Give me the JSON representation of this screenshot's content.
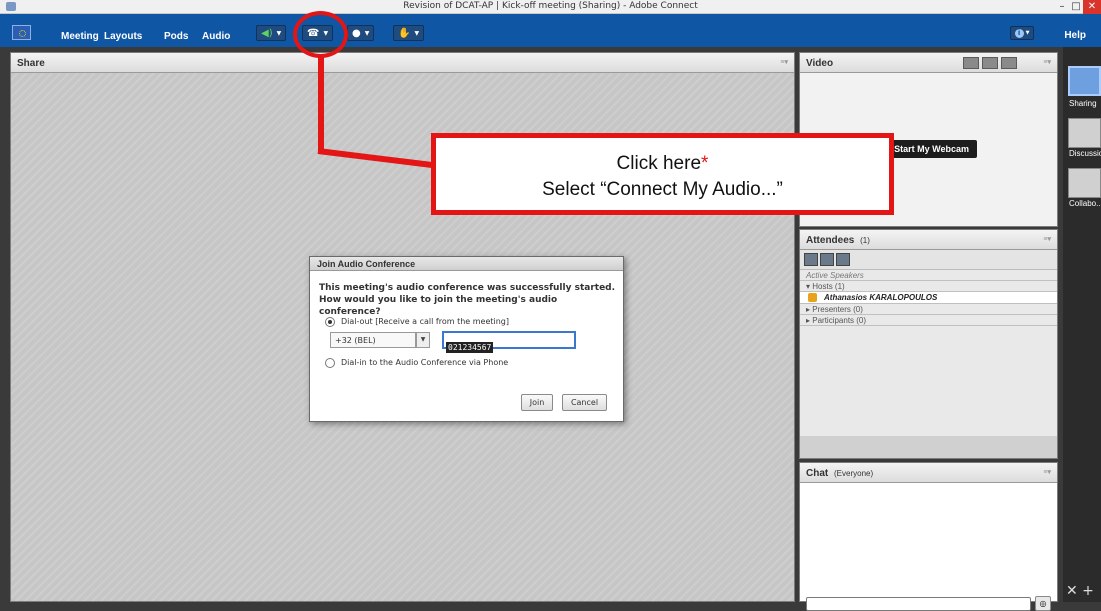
{
  "window": {
    "title": "Revision of DCAT-AP | Kick-off meeting (Sharing) - Adobe Connect",
    "minimize": "–",
    "maximize": "□",
    "close": "✕"
  },
  "menubar": {
    "items": [
      "Meeting",
      "Layouts",
      "Pods",
      "Audio"
    ],
    "help": "Help"
  },
  "toolbar": {
    "speaker_icon": "speaker-icon",
    "phone_icon": "phone-icon",
    "webcam_icon": "webcam-icon",
    "raisehand_icon": "raise-hand-icon",
    "caret": "▼"
  },
  "share": {
    "title": "Share"
  },
  "video": {
    "title": "Video",
    "webcam_button": "Start My Webcam"
  },
  "attendees": {
    "title": "Attendees",
    "count": "(1)",
    "active_speakers": "Active Speakers",
    "hosts": "▾ Hosts (1)",
    "host_name": "Athanasios KARALOPOULOS",
    "presenters": "▸ Presenters (0)",
    "participants": "▸ Participants (0)"
  },
  "chat": {
    "title": "Chat",
    "scope": "(Everyone)"
  },
  "layouts": {
    "items": [
      "Sharing",
      "Discussion",
      "Collabo..."
    ]
  },
  "dialog": {
    "title": "Join Audio Conference",
    "message_line1": "This meeting's audio conference was successfully started.",
    "message_line2": "How would you like to join the meeting's audio conference?",
    "option_dialout": "Dial-out [Receive a call from the meeting]",
    "country_code": "+32 (BEL)",
    "phone_number": "021234567",
    "option_dialin": "Dial-in to the Audio Conference via Phone",
    "join": "Join",
    "cancel": "Cancel"
  },
  "callout": {
    "line1": "Click here",
    "asterisk": "*",
    "line2": "Select “Connect My Audio...”"
  },
  "colors": {
    "menubar": "#0f56a5",
    "callout_red": "#e31515"
  }
}
